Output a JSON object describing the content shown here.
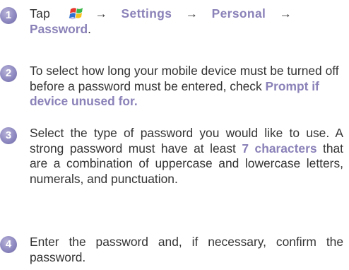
{
  "steps": [
    {
      "number": "1",
      "tap": "Tap",
      "arrow": "→",
      "settings": "Settings",
      "personal": "Personal",
      "password": "Password",
      "period": "."
    },
    {
      "number": "2",
      "text": "To select how long your mobile device must be turned off before a password must be entered, check ",
      "highlight": "Prompt if device unused for."
    },
    {
      "number": "3",
      "text_before": "Select the type of password you would like to use. A strong password must have at least ",
      "highlight": "7 characters",
      "text_after": " that are a combination of uppercase and lowercase letters, numerals, and punctuation."
    },
    {
      "number": "4",
      "text": "Enter the password and, if necessary, confirm the password."
    }
  ],
  "icons": {
    "start": "windows-start-icon"
  }
}
